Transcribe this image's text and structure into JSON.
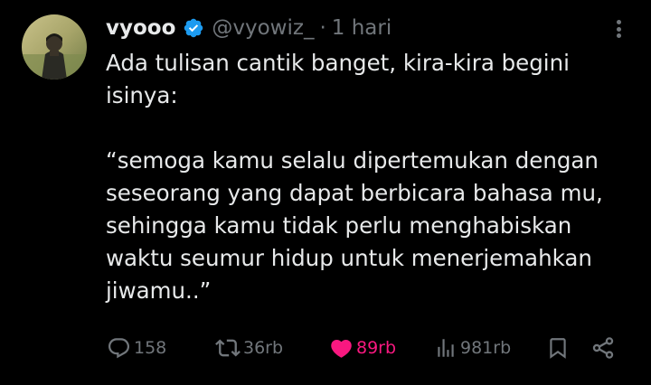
{
  "tweet": {
    "author": {
      "display_name": "vyooo",
      "handle": "@vyowiz_",
      "verified": true,
      "avatar_icon": "profile-photo"
    },
    "separator": "·",
    "time": "1 hari",
    "text_lines": [
      "Ada tulisan cantik banget, kira-kira begini",
      "isinya:",
      "",
      "“semoga kamu selalu dipertemukan dengan",
      "seseorang yang dapat berbicara bahasa mu,",
      "sehingga kamu tidak perlu menghabiskan",
      "waktu seumur hidup untuk menerjemahkan",
      "jiwamu..”"
    ],
    "actions": {
      "replies": "158",
      "retweets": "36rb",
      "likes": "89rb",
      "liked": true,
      "views": "981rb"
    }
  },
  "colors": {
    "background": "#000000",
    "text": "#e7e9ea",
    "muted": "#71767b",
    "verified": "#1d9bf0",
    "like": "#f91880"
  }
}
